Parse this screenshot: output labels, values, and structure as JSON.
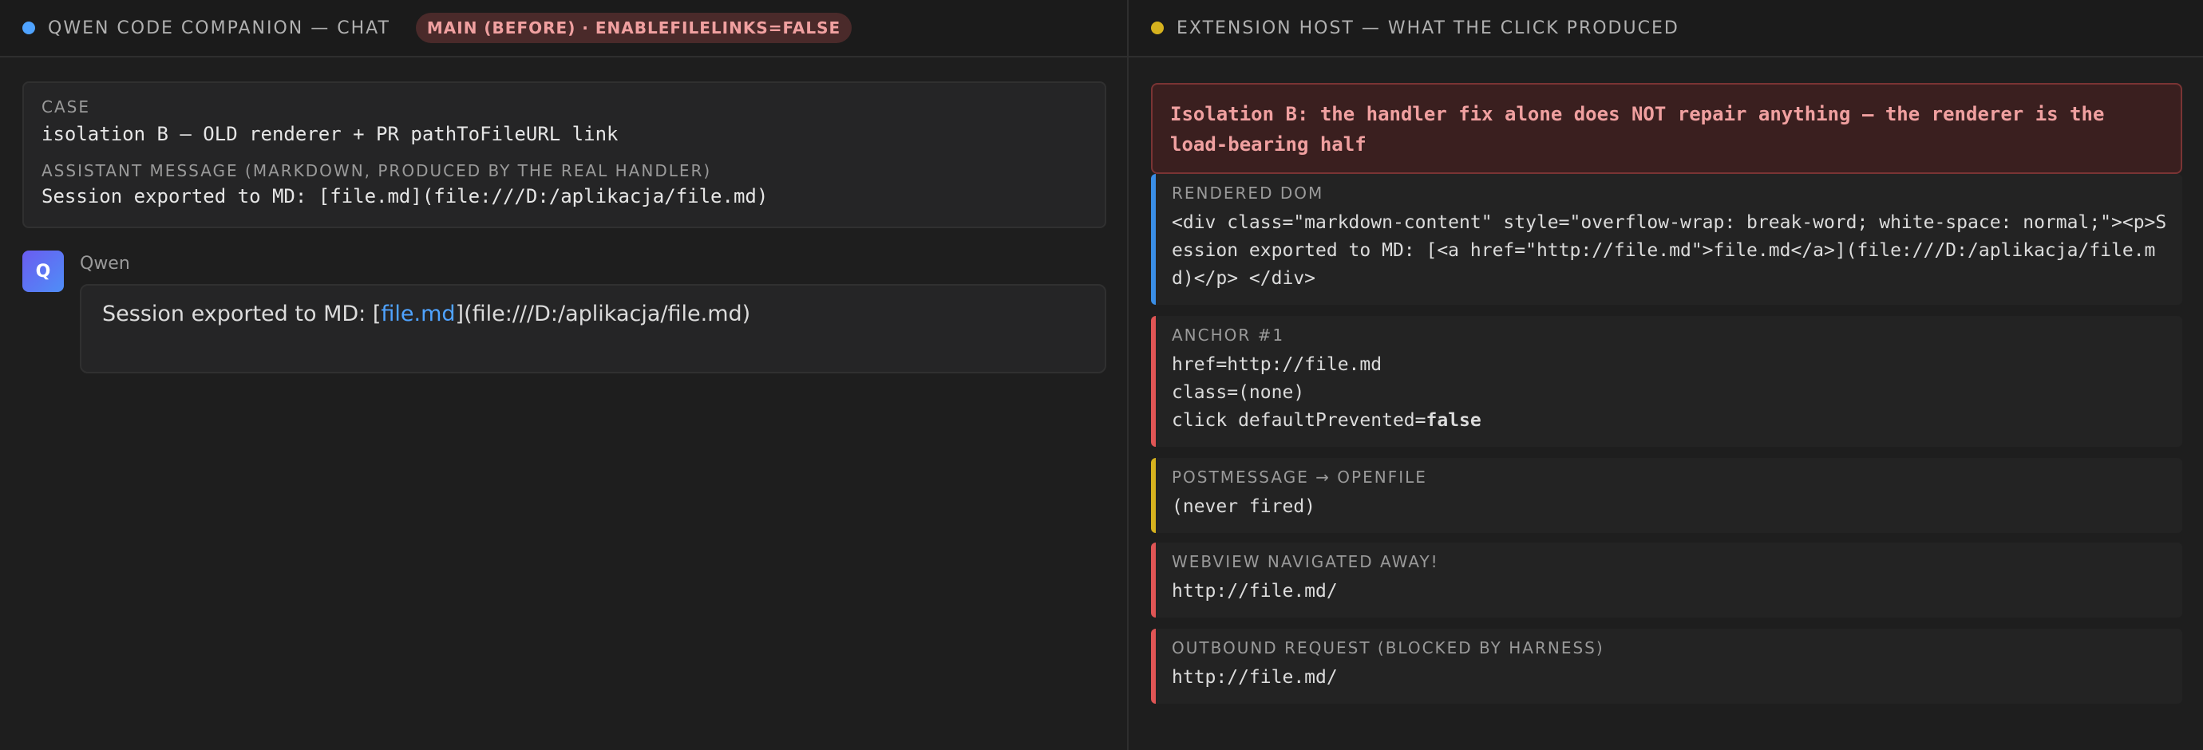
{
  "left": {
    "header": {
      "title": "QWEN CODE COMPANION — CHAT",
      "badge": "MAIN (BEFORE) · ENABLEFILELINKS=FALSE",
      "dot_color": "#4fa3ff"
    },
    "case": {
      "label": "CASE",
      "value": "isolation B — OLD renderer + PR pathToFileURL link",
      "message_label": "ASSISTANT MESSAGE (MARKDOWN, PRODUCED BY THE REAL HANDLER)",
      "message_value": "Session exported to MD: [file.md](file:///D:/aplikacja/file.md)"
    },
    "chat": {
      "avatar_letter": "Q",
      "sender": "Qwen",
      "text_before": "Session exported to MD: [",
      "link_text": "file.md",
      "text_after": "](file:///D:/aplikacja/file.md)",
      "link_color": "#4fa3ff"
    }
  },
  "right": {
    "header": {
      "title": "EXTENSION HOST — WHAT THE CLICK PRODUCED",
      "dot_color": "#d6b21e"
    },
    "alert": "Isolation B: the handler fix alone does NOT repair anything — the renderer is the load-bearing half",
    "rendered_dom": {
      "label": "RENDERED DOM",
      "value": "<div class=\"markdown-content\" style=\"overflow-wrap: break-word; white-space: normal;\"><p>Session exported to MD: [<a href=\"http://file.md\">file.md</a>](file:///D:/aplikacja/file.md)</p> </div>"
    },
    "anchor": {
      "label": "ANCHOR #1",
      "href": "href=http://file.md",
      "class": "class=(none)",
      "click_prefix": "click defaultPrevented=",
      "click_value": "false"
    },
    "postmessage": {
      "label": "POSTMESSAGE → OPENFILE",
      "value": "(never fired)"
    },
    "navigated": {
      "label": "WEBVIEW NAVIGATED AWAY!",
      "value": "http://file.md/"
    },
    "outbound": {
      "label": "OUTBOUND REQUEST (BLOCKED BY HARNESS)",
      "value": "http://file.md/"
    }
  }
}
